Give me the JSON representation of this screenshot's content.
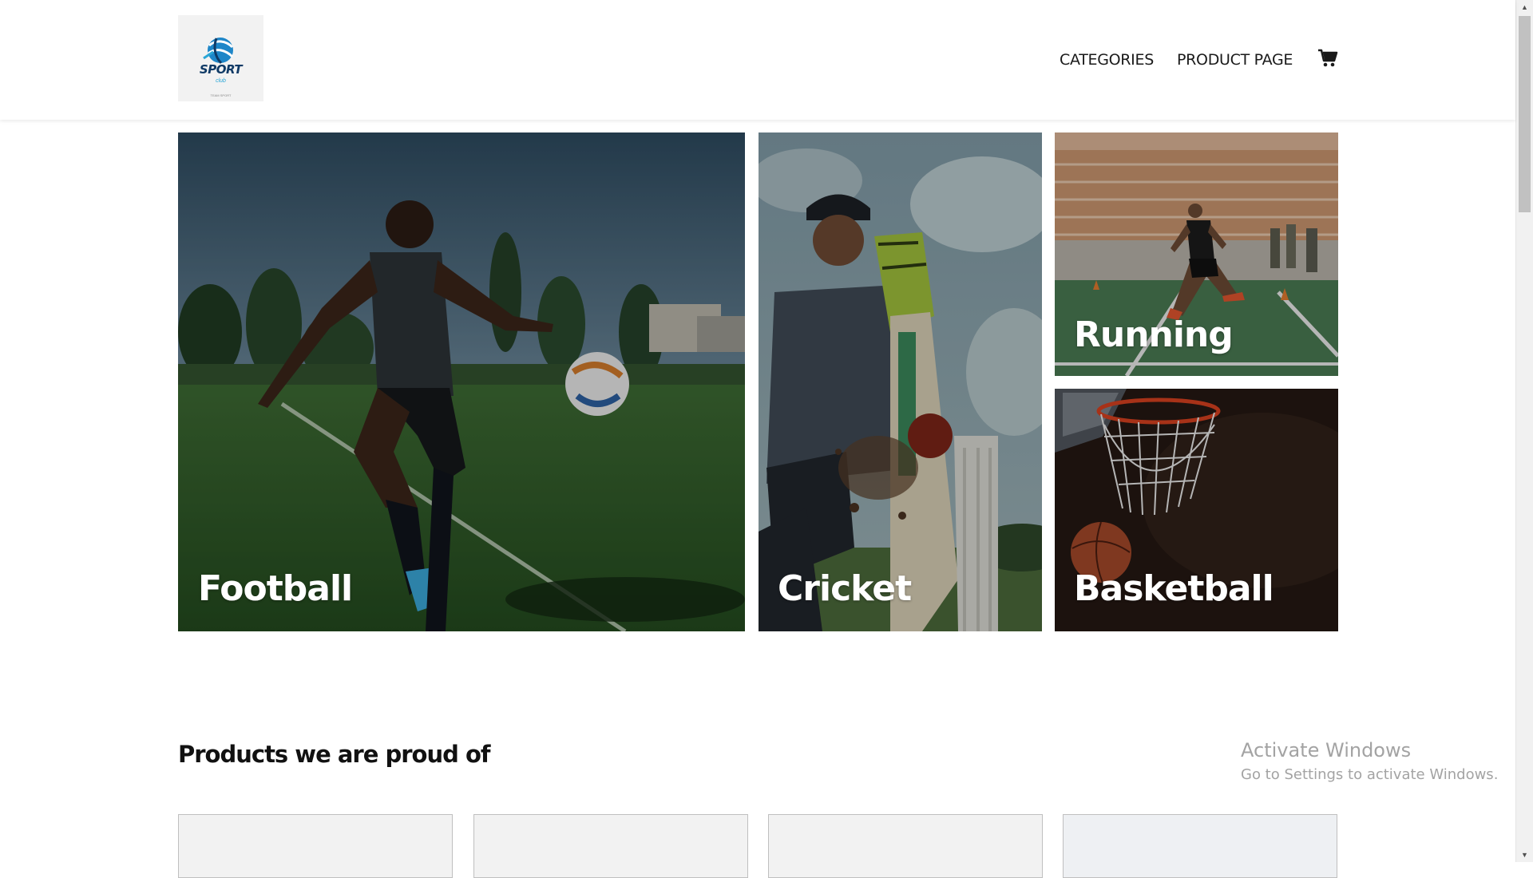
{
  "header": {
    "logo": {
      "icon": "sport-ball-logo",
      "title": "SPORT",
      "subtitle": "club",
      "tagline": "TEAM SPORT"
    },
    "nav": [
      {
        "label": "CATEGORIES"
      },
      {
        "label": "PRODUCT PAGE"
      }
    ],
    "cart_icon": "shopping-cart-icon"
  },
  "categories": [
    {
      "label": "Football"
    },
    {
      "label": "Cricket"
    },
    {
      "label": "Running"
    },
    {
      "label": "Basketball"
    }
  ],
  "products_section": {
    "title": "Products we are proud of"
  },
  "watermark": {
    "title": "Activate Windows",
    "subtitle": "Go to Settings to activate Windows."
  },
  "scrollbar": {
    "up_icon": "scroll-up-arrow-icon",
    "down_icon": "scroll-down-arrow-icon"
  },
  "colors": {
    "brand_blue": "#0f3a66",
    "brand_cyan": "#2aa6d6",
    "text": "#111111",
    "card_bg": "#f2f2f2"
  }
}
